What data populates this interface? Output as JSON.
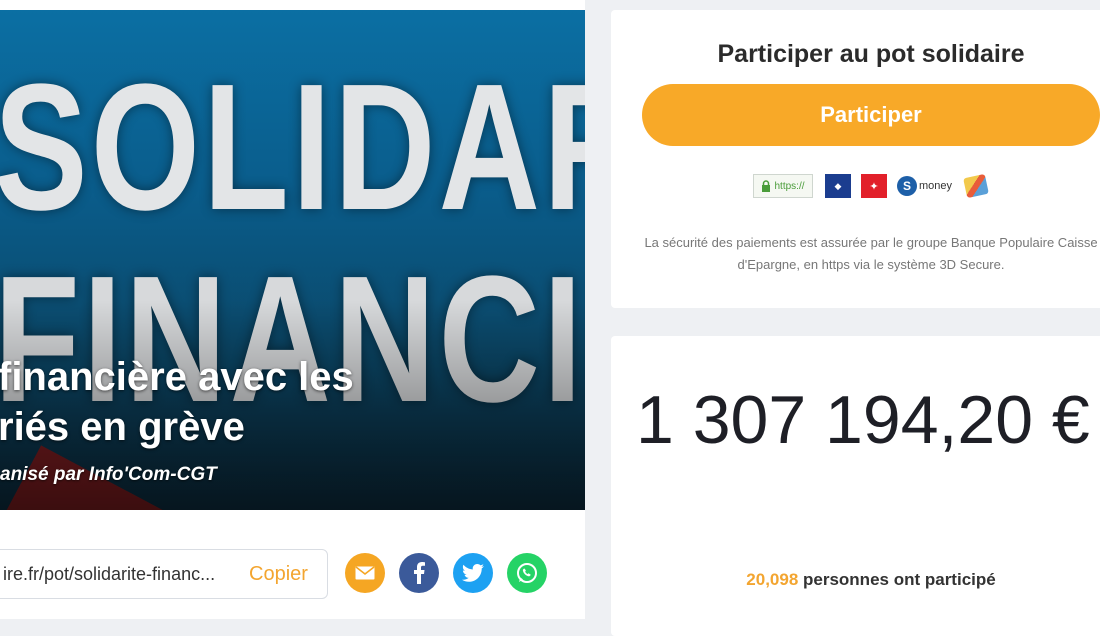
{
  "hero": {
    "bg_word_1": "SOLIDARITÉ",
    "bg_word_2": "FINANCIÈRE",
    "title_line_1": "financière avec les",
    "title_line_2": "riés en grève",
    "organizer": "anisé par Info'Com-CGT"
  },
  "share": {
    "url": "ire.fr/pot/solidarite-financ...",
    "copy_label": "Copier",
    "icons": [
      "mail-icon",
      "facebook-icon",
      "twitter-icon",
      "whatsapp-icon"
    ]
  },
  "participate_card": {
    "title": "Participer au pot solidaire",
    "button_label": "Participer",
    "badge_https": "https://",
    "badge_smoney": "money",
    "security_text": "La sécurité des paiements est assurée par le groupe Banque Populaire Caisse d'Epargne, en https via le système 3D Secure."
  },
  "stats_card": {
    "amount": "1 307 194,20 €",
    "participant_count": "20,098",
    "participant_label": " personnes ont participé"
  },
  "colors": {
    "accent": "#f8a928",
    "hero_blue": "#0b6fa3"
  }
}
